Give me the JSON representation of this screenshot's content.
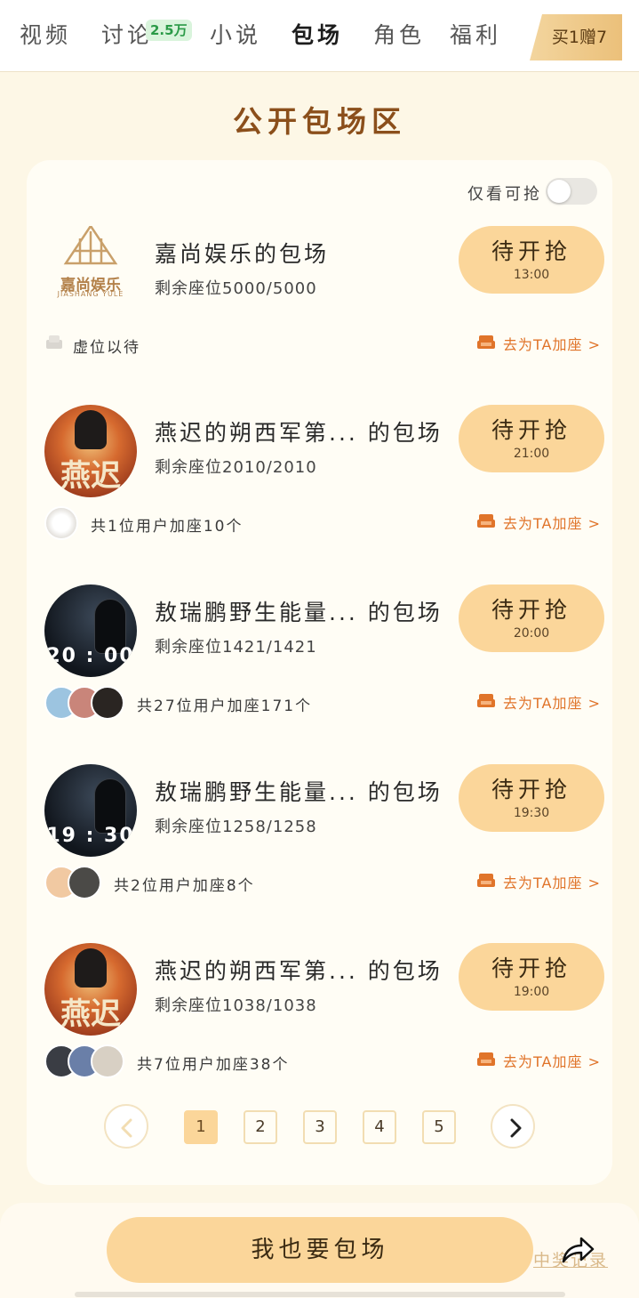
{
  "top_tabs": [
    {
      "label": "视频"
    },
    {
      "label": "讨论",
      "badge": "2.5万"
    },
    {
      "label": "小说"
    },
    {
      "label": "包场"
    },
    {
      "label": "角色"
    },
    {
      "label": "福利"
    }
  ],
  "active_tab": "包场",
  "promo_label": "买1赠7",
  "section_title": "公开包场区",
  "filter": {
    "label": "仅看可抢",
    "on": false
  },
  "items": [
    {
      "title": "嘉尚娱乐的包场",
      "seats": "剩余座位5000/5000",
      "button": "待开抢",
      "time": "13:00",
      "supporters_text": "虚位以待",
      "add_link": "去为TA加座 >",
      "avatar_logo_text": "嘉尚娱乐",
      "avatar_logo_sub": "JIASHANG YULE"
    },
    {
      "title": "燕迟的朔西军第... 的包场",
      "seats": "剩余座位2010/2010",
      "button": "待开抢",
      "time": "21:00",
      "supporters_text": "共1位用户加座10个",
      "add_link": "去为TA加座 >",
      "avatar_text": "燕迟"
    },
    {
      "title": "敖瑞鹏野生能量... 的包场",
      "seats": "剩余座位1421/1421",
      "button": "待开抢",
      "time": "20:00",
      "supporters_text": "共27位用户加座171个",
      "add_link": "去为TA加座 >",
      "avatar_text": "20 : 00"
    },
    {
      "title": "敖瑞鹏野生能量... 的包场",
      "seats": "剩余座位1258/1258",
      "button": "待开抢",
      "time": "19:30",
      "supporters_text": "共2位用户加座8个",
      "add_link": "去为TA加座 >",
      "avatar_text": "19 : 30"
    },
    {
      "title": "燕迟的朔西军第... 的包场",
      "seats": "剩余座位1038/1038",
      "button": "待开抢",
      "time": "19:00",
      "supporters_text": "共7位用户加座38个",
      "add_link": "去为TA加座 >",
      "avatar_text": "燕迟"
    }
  ],
  "pagination": {
    "pages": [
      "1",
      "2",
      "3",
      "4",
      "5"
    ],
    "current": "1"
  },
  "bottom": {
    "cta": "我也要包场",
    "record_link": "中奖记录"
  },
  "colors": {
    "accent": "#fbd69a",
    "link": "#e0742a",
    "title": "#8b4f1b",
    "background": "#fdf7e6"
  },
  "icons": {
    "prev": "chevron-left-icon",
    "next": "chevron-right-icon",
    "sofa": "sofa-icon",
    "share": "share-icon"
  }
}
